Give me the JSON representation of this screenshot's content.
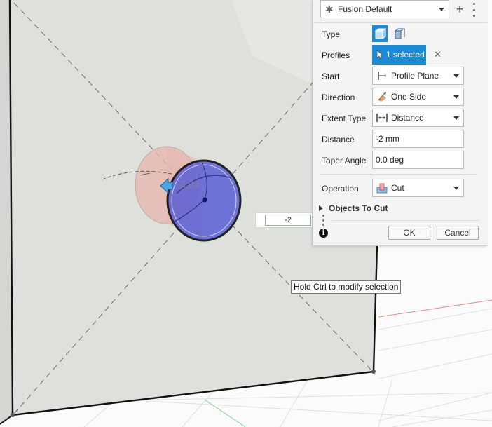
{
  "viewport": {
    "dimension_label": "2.00",
    "dimension_input_value": "-2",
    "tooltip": "Hold Ctrl to modify selection"
  },
  "panel": {
    "preset": {
      "value": "Fusion Default",
      "icon": "star-icon"
    },
    "add_icon": "plus-icon",
    "more_icon": "kebab-icon",
    "fields": {
      "type": {
        "label": "Type"
      },
      "profiles": {
        "label": "Profiles",
        "value": "1 selected"
      },
      "start": {
        "label": "Start",
        "value": "Profile Plane"
      },
      "direction": {
        "label": "Direction",
        "value": "One Side"
      },
      "extent_type": {
        "label": "Extent Type",
        "value": "Distance"
      },
      "distance": {
        "label": "Distance",
        "value": "-2 mm"
      },
      "taper_angle": {
        "label": "Taper Angle",
        "value": "0.0 deg"
      },
      "operation": {
        "label": "Operation",
        "value": "Cut"
      }
    },
    "objects_to_cut": "Objects To Cut",
    "ok_label": "OK",
    "cancel_label": "Cancel",
    "info_icon": "i"
  },
  "colors": {
    "accent": "#1b8bd8",
    "profile_fill": "#5a5fd6",
    "cut_preview": "#e8b6ad",
    "body_face": "#dcdfda",
    "grid_red": "#e08a8a",
    "grid_green": "#7ad38a"
  }
}
